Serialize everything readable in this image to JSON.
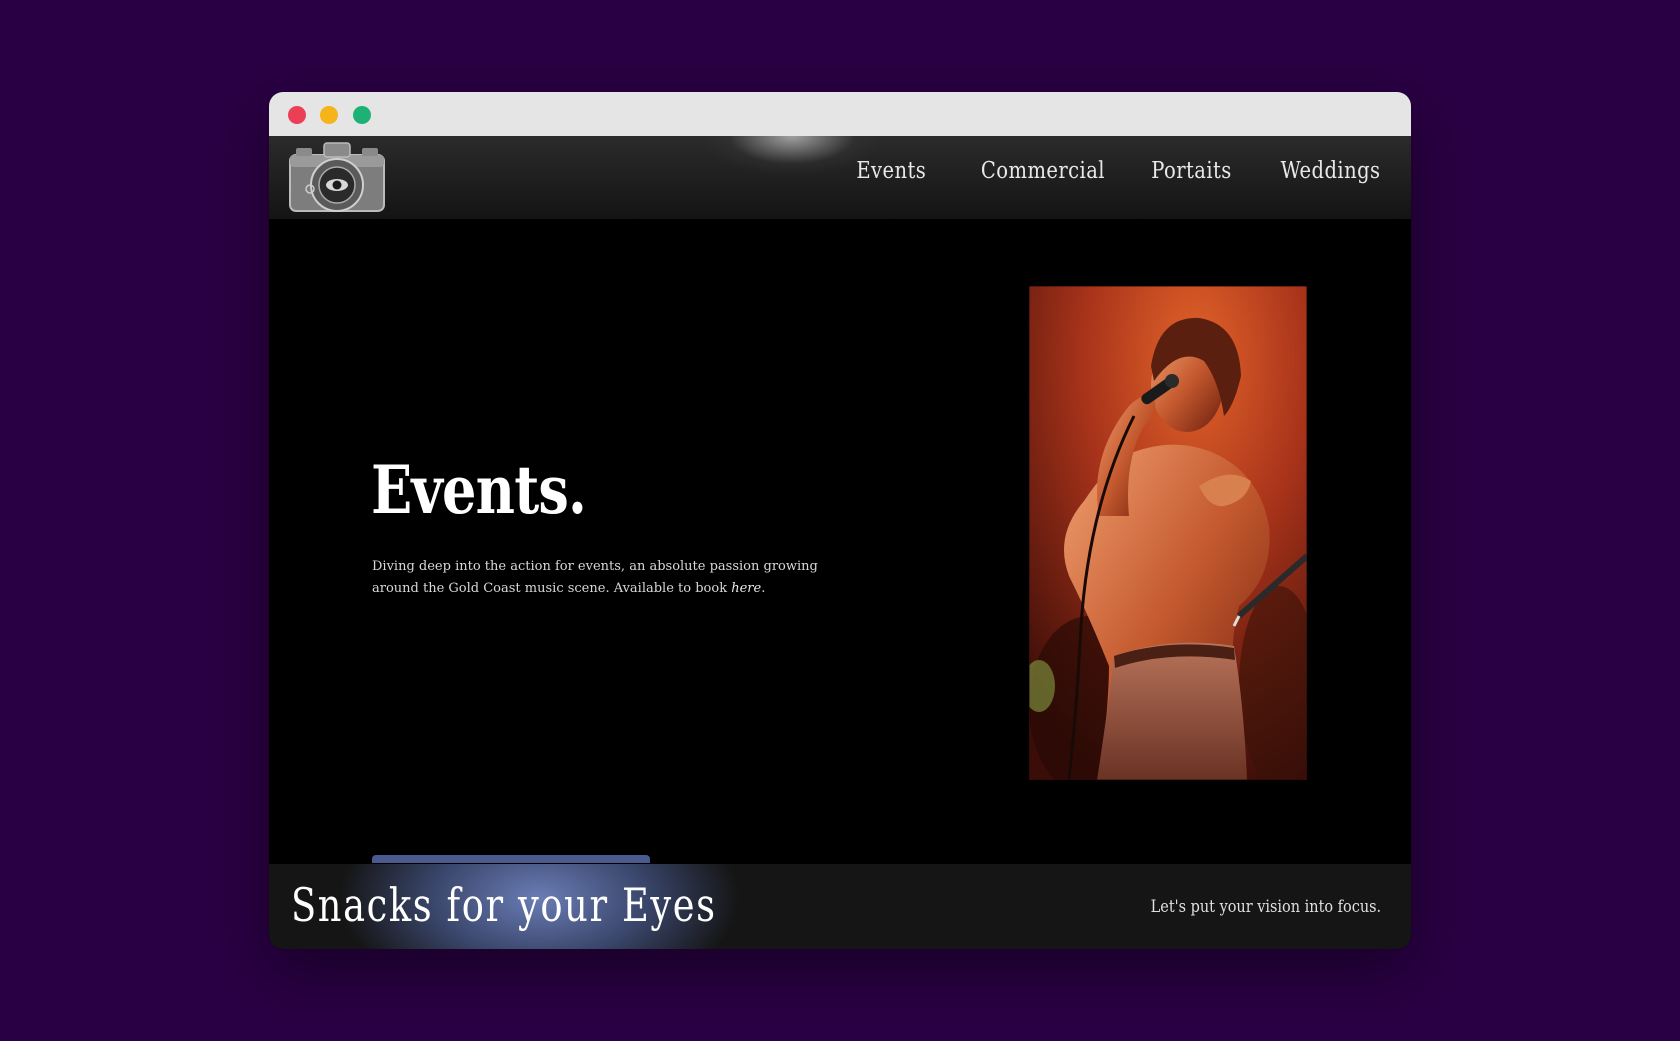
{
  "navigation": {
    "items": [
      {
        "label": "Events"
      },
      {
        "label": "Commercial"
      },
      {
        "label": "Portaits"
      },
      {
        "label": "Weddings"
      }
    ]
  },
  "hero": {
    "title": "Events.",
    "description_text": "Diving deep into the action for events, an absolute passion growing around the Gold Coast music scene. Available to book ",
    "description_link": "here",
    "description_end": ".",
    "image_icon": "performer-photo"
  },
  "footer": {
    "brand": "Snacks for your Eyes",
    "tagline": "Let's put your vision into focus."
  },
  "colors": {
    "page_background": "#2a0044",
    "site_background": "#000000",
    "accent": "#4a5a90",
    "text": "#ffffff"
  }
}
